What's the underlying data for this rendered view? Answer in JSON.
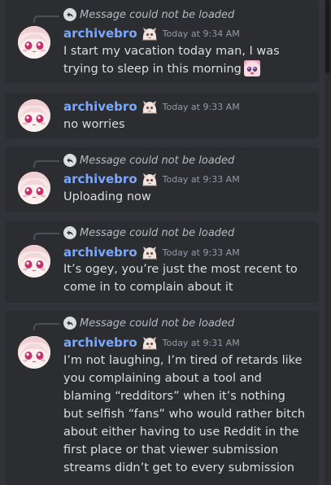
{
  "messages": [
    {
      "reply": "Message could not be loaded",
      "username": "archivebro",
      "timestamp": "Today at 9:34 AM",
      "content": "I start my vacation today man, I was trying to sleep in this morning"
    },
    {
      "username": "archivebro",
      "timestamp": "Today at 9:33 AM",
      "content": "no worries"
    },
    {
      "reply": "Message could not be loaded",
      "username": "archivebro",
      "timestamp": "Today at 9:33 AM",
      "content": "Uploading now"
    },
    {
      "reply": "Message could not be loaded",
      "username": "archivebro",
      "timestamp": "Today at 9:33 AM",
      "content": "It’s ogey, you’re just the most recent to come in to complain about it"
    },
    {
      "reply": "Message could not be loaded",
      "username": "archivebro",
      "timestamp": "Today at 9:31 AM",
      "content": "I’m not laughing, I’m tired of retards like you complaining about a tool and blaming “redditors” when it’s nothing but selfish “fans” who would rather bitch about either having to use Reddit in the first place or that viewer submission streams didn’t get to every submission"
    }
  ],
  "colors": {
    "background": "#313338",
    "message_hover": "#2b2d31",
    "username": "#7aa8ff",
    "timestamp": "#949ba4",
    "text": "#dbdee1"
  },
  "icons": {
    "reply": "reply-arrow-icon",
    "badge": "chibi-emoji-badge-icon",
    "inline_emoji": "anime-girl-emoji-icon"
  }
}
